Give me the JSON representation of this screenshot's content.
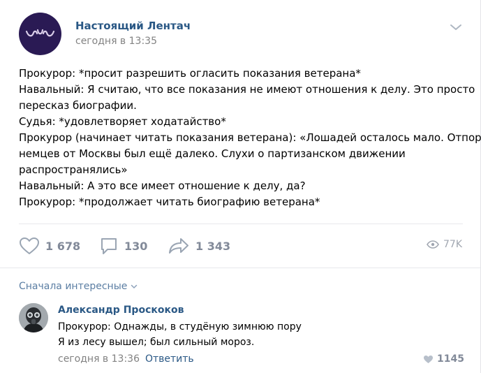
{
  "post": {
    "group_name": "Настоящий Лентач",
    "time": "сегодня в 13:35",
    "lines": [
      "Прокурор: *просит разрешить огласить показания ветерана*",
      "Навальный: Я считаю, что все показания не имеют отношения к делу. Это просто",
      "пересказ биографии.",
      "Судья: *удовлетворяет ходатайство*",
      "Прокурор (начинает читать показания ветерана): «Лошадей осталось мало. Отпор",
      "немцев от Москвы был ещё далеко. Слухи о партизанском движении",
      "распространялись»",
      "Навальный: А это все имеет отношение к делу, да?",
      "Прокурор: *продолжает читать биографию ветерана*"
    ],
    "likes": "1 678",
    "comments": "130",
    "shares": "1 343",
    "views": "77K"
  },
  "comments_section": {
    "sort_label": "Сначала интересные",
    "comment": {
      "author": "Александр Проскоков",
      "lines": [
        "Прокурор: Однажды, в студёную зимнюю пору",
        "Я из лесу вышел; был сильный мороз."
      ],
      "time": "сегодня в 13:36",
      "reply_label": "Ответить",
      "likes": "1145"
    }
  },
  "icons": {
    "menu": "chevron-down-icon",
    "like": "heart-icon",
    "comment": "comment-bubble-icon",
    "share": "share-arrow-icon",
    "views": "eye-icon"
  },
  "colors": {
    "link": "#2a5885",
    "muted": "#828282",
    "action": "#828a99",
    "group_avatar": "#2a1a54"
  }
}
